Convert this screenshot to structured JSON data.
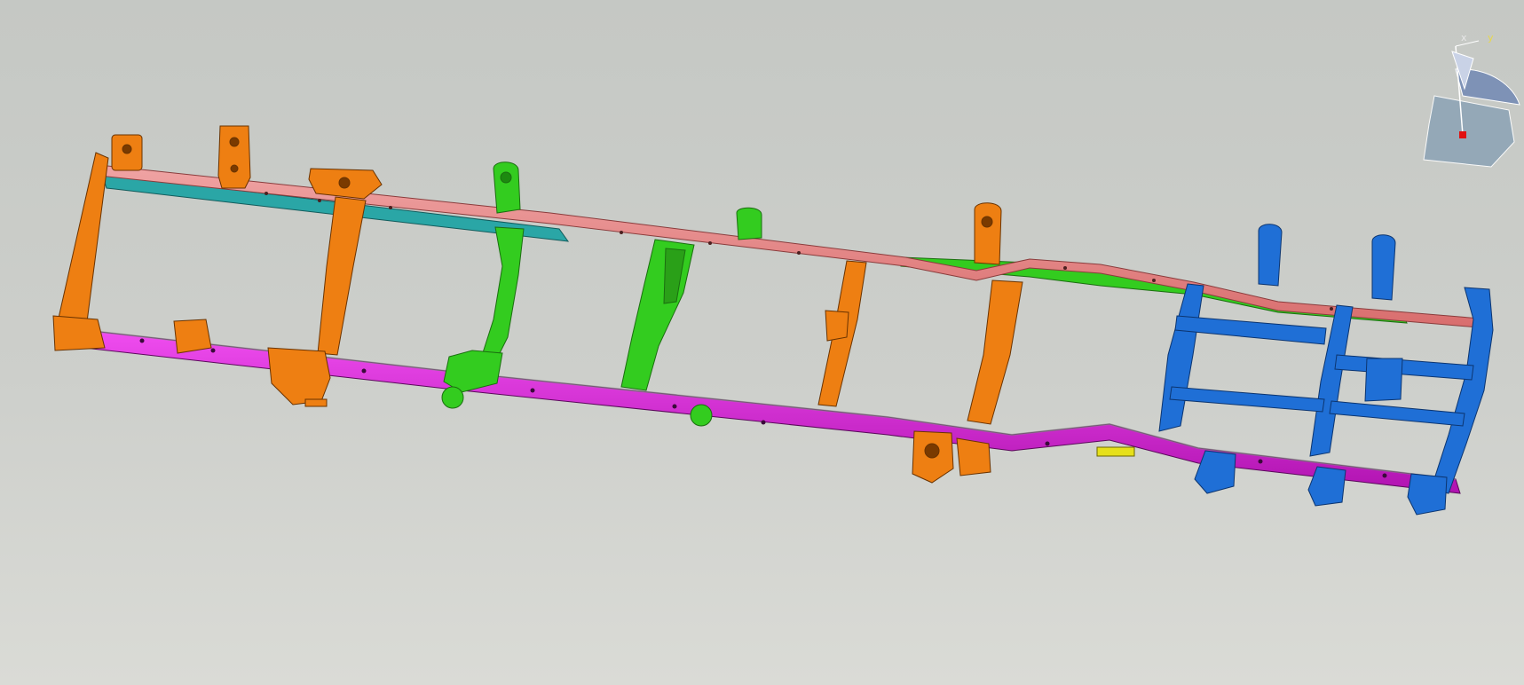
{
  "viewport": {
    "background_top": "#c5c8c4",
    "background_bottom": "#dadbd6"
  },
  "compass": {
    "x_label": "x",
    "y_label": "y",
    "icon": "orientation-compass-icon"
  },
  "model": {
    "part_colors": {
      "upper_rail": "#e88a8a",
      "upper_rail_inner": "#2aa6a6",
      "lower_rail": "#d81ed8",
      "front_members": "#ee7f12",
      "mid_members": "#33cc1f",
      "rear_members": "#1f6fd6",
      "small_part": "#e6e01a"
    }
  }
}
